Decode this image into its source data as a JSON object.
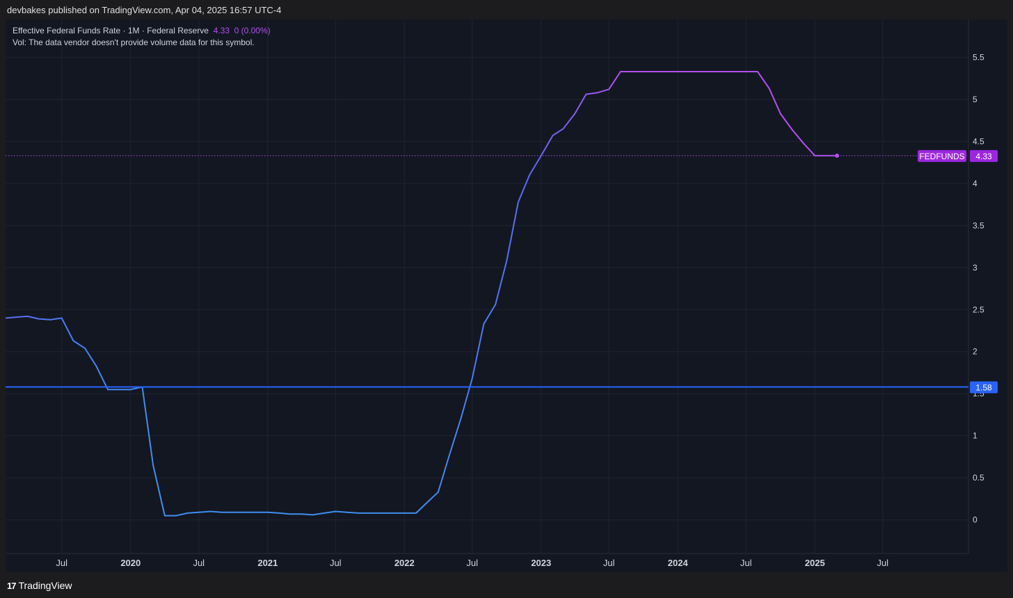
{
  "header": {
    "published": "devbakes published on TradingView.com, Apr 04, 2025 16:57 UTC-4"
  },
  "legend": {
    "title": "Effective Federal Funds Rate · 1M · Federal Reserve",
    "value": "4.33",
    "change": "0 (0.00%)",
    "vol": "Vol: The data vendor doesn't provide volume data for this symbol."
  },
  "footer": {
    "brand": "TradingView",
    "logo_icon": "tradingview-logo-icon"
  },
  "colors": {
    "background": "#131722",
    "grid": "#1f2433",
    "axis_text": "#d1d4dc",
    "line_start": "#3f8ef0",
    "line_mid": "#5b6af5",
    "line_end": "#b44ff0",
    "hline": "#2962ff",
    "price_badge": "#9c27e0"
  },
  "chart_data": {
    "type": "line",
    "symbol": "FEDFUNDS",
    "last_value": 4.33,
    "last_label": "4.33",
    "horizontal_line": {
      "value": 1.58,
      "label": "1.58"
    },
    "y_ticks": [
      0,
      0.5,
      1,
      1.5,
      2,
      2.5,
      3,
      3.5,
      4,
      4.5,
      5,
      5.5
    ],
    "y_tick_labels": [
      "0",
      "0.5",
      "1",
      "1.5",
      "2",
      "2.5",
      "3",
      "3.5",
      "4",
      "4.5",
      "5",
      "5.5"
    ],
    "ylim": [
      -0.4,
      5.95
    ],
    "xlim": [
      "2019-02-01",
      "2026-02-15"
    ],
    "x_ticks": [
      {
        "date": "2019-07-01",
        "label": "Jul",
        "bold": false
      },
      {
        "date": "2020-01-01",
        "label": "2020",
        "bold": true
      },
      {
        "date": "2020-07-01",
        "label": "Jul",
        "bold": false
      },
      {
        "date": "2021-01-01",
        "label": "2021",
        "bold": true
      },
      {
        "date": "2021-07-01",
        "label": "Jul",
        "bold": false
      },
      {
        "date": "2022-01-01",
        "label": "2022",
        "bold": true
      },
      {
        "date": "2022-07-01",
        "label": "Jul",
        "bold": false
      },
      {
        "date": "2023-01-01",
        "label": "2023",
        "bold": true
      },
      {
        "date": "2023-07-01",
        "label": "Jul",
        "bold": false
      },
      {
        "date": "2024-01-01",
        "label": "2024",
        "bold": true
      },
      {
        "date": "2024-07-01",
        "label": "Jul",
        "bold": false
      },
      {
        "date": "2025-01-01",
        "label": "2025",
        "bold": true
      },
      {
        "date": "2025-07-01",
        "label": "Jul",
        "bold": false
      }
    ],
    "series": [
      {
        "x": [
          "2019-02-01",
          "2019-03-01",
          "2019-04-01",
          "2019-05-01",
          "2019-06-01",
          "2019-07-01",
          "2019-08-01",
          "2019-09-01",
          "2019-10-01",
          "2019-11-01",
          "2019-12-01",
          "2020-01-01",
          "2020-02-01",
          "2020-03-01",
          "2020-04-01",
          "2020-05-01",
          "2020-06-01",
          "2020-07-01",
          "2020-08-01",
          "2020-09-01",
          "2020-10-01",
          "2020-11-01",
          "2020-12-01",
          "2021-01-01",
          "2021-02-01",
          "2021-03-01",
          "2021-04-01",
          "2021-05-01",
          "2021-06-01",
          "2021-07-01",
          "2021-08-01",
          "2021-09-01",
          "2021-10-01",
          "2021-11-01",
          "2021-12-01",
          "2022-01-01",
          "2022-02-01",
          "2022-03-01",
          "2022-04-01",
          "2022-05-01",
          "2022-06-01",
          "2022-07-01",
          "2022-08-01",
          "2022-09-01",
          "2022-10-01",
          "2022-11-01",
          "2022-12-01",
          "2023-01-01",
          "2023-02-01",
          "2023-03-01",
          "2023-04-01",
          "2023-05-01",
          "2023-06-01",
          "2023-07-01",
          "2023-08-01",
          "2023-09-01",
          "2023-10-01",
          "2023-11-01",
          "2023-12-01",
          "2024-01-01",
          "2024-02-01",
          "2024-03-01",
          "2024-04-01",
          "2024-05-01",
          "2024-06-01",
          "2024-07-01",
          "2024-08-01",
          "2024-09-01",
          "2024-10-01",
          "2024-11-01",
          "2024-12-01",
          "2025-01-01",
          "2025-02-01",
          "2025-03-01"
        ],
        "values": [
          2.4,
          2.41,
          2.42,
          2.39,
          2.38,
          2.4,
          2.13,
          2.04,
          1.83,
          1.55,
          1.55,
          1.55,
          1.58,
          0.65,
          0.05,
          0.05,
          0.08,
          0.09,
          0.1,
          0.09,
          0.09,
          0.09,
          0.09,
          0.09,
          0.08,
          0.07,
          0.07,
          0.06,
          0.08,
          0.1,
          0.09,
          0.08,
          0.08,
          0.08,
          0.08,
          0.08,
          0.08,
          0.2,
          0.33,
          0.77,
          1.21,
          1.68,
          2.33,
          2.56,
          3.08,
          3.78,
          4.1,
          4.33,
          4.57,
          4.65,
          4.83,
          5.06,
          5.08,
          5.12,
          5.33,
          5.33,
          5.33,
          5.33,
          5.33,
          5.33,
          5.33,
          5.33,
          5.33,
          5.33,
          5.33,
          5.33,
          5.33,
          5.13,
          4.83,
          4.64,
          4.48,
          4.33,
          4.33,
          4.33
        ]
      }
    ]
  }
}
